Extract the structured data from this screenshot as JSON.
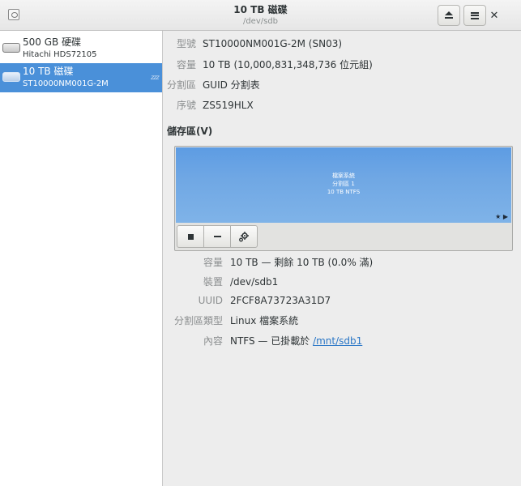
{
  "header": {
    "title": "10 TB 磁碟",
    "subtitle": "/dev/sdb",
    "left_icon": "disks-app-icon",
    "eject_icon": "eject-icon",
    "menu_icon": "menu-icon",
    "close_glyph": "✕"
  },
  "sidebar": {
    "drives": [
      {
        "name": "500 GB 硬碟",
        "model": "Hitachi HDS72105"
      },
      {
        "name": "10 TB 磁碟",
        "model": "ST10000NM001G-2M",
        "selected": true,
        "status_glyph": "zzz"
      }
    ]
  },
  "drive_info": {
    "model_label": "型號",
    "model_value": "ST10000NM001G-2M (SN03)",
    "size_label": "容量",
    "size_value": "10 TB (10,000,831,348,736 位元組)",
    "partitioning_label": "分割區",
    "partitioning_value": "GUID 分割表",
    "serial_label": "序號",
    "serial_value": "ZS519HLX"
  },
  "volumes": {
    "title": "儲存區(V)",
    "partition": {
      "line1": "檔案系統",
      "line2": "分割區 1",
      "line3": "10 TB NTFS",
      "flags": "★ ▶"
    },
    "toolbar": [
      "stop-icon",
      "minus-icon",
      "gears-icon"
    ]
  },
  "partition_info": {
    "size_label": "容量",
    "size_value": "10 TB — 剩餘 10 TB (0.0% 滿)",
    "device_label": "裝置",
    "device_value": "/dev/sdb1",
    "uuid_label": "UUID",
    "uuid_value": "2FCF8A73723A31D7",
    "type_label": "分割區類型",
    "type_value": "Linux 檔案系統",
    "contents_label": "內容",
    "contents_prefix": "NTFS — 已掛載於 ",
    "contents_link": "/mnt/sdb1"
  },
  "colors": {
    "selection": "#4a90d9",
    "partition": "#6fa7e4",
    "link": "#2a76c6"
  }
}
